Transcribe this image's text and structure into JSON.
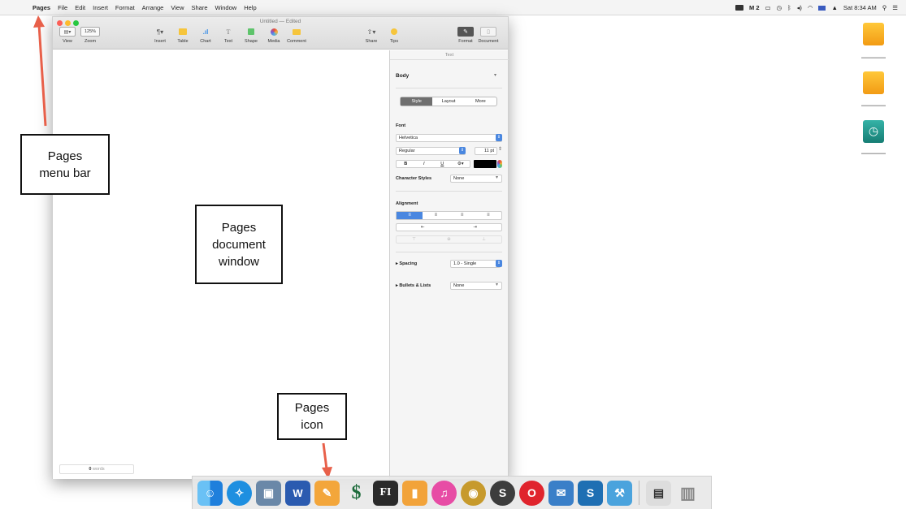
{
  "menubar": {
    "apple_glyph": "",
    "items": [
      "Pages",
      "File",
      "Edit",
      "Insert",
      "Format",
      "Arrange",
      "View",
      "Share",
      "Window",
      "Help"
    ],
    "status": {
      "battery_badge": "2",
      "clock": "Sat 8:34 AM"
    }
  },
  "window": {
    "title": "Untitled — Edited",
    "toolbar": {
      "view_label": "View",
      "zoom_value": "125%",
      "zoom_label": "Zoom",
      "insert_label": "Insert",
      "table_label": "Table",
      "chart_label": "Chart",
      "text_label": "Text",
      "shape_label": "Shape",
      "media_label": "Media",
      "comment_label": "Comment",
      "share_label": "Share",
      "tips_label": "Tips",
      "format_label": "Format",
      "document_label": "Document"
    },
    "word_count": {
      "number": "0",
      "unit": "words"
    }
  },
  "inspector": {
    "header": "Text",
    "paragraph_style": "Body",
    "tabs": [
      "Style",
      "Layout",
      "More"
    ],
    "font_section": "Font",
    "font_family": "Helvetica",
    "typeface": "Regular",
    "font_size": "11 pt",
    "format_buttons": [
      "B",
      "I",
      "U"
    ],
    "char_styles_label": "Character Styles",
    "char_styles_value": "None",
    "alignment_section": "Alignment",
    "spacing_label": "Spacing",
    "spacing_value": "1.0 - Single",
    "bullets_label": "Bullets & Lists",
    "bullets_value": "None"
  },
  "annotations": {
    "menubar_note": [
      "Pages",
      "menu bar"
    ],
    "window_note": [
      "Pages",
      "document",
      "window"
    ],
    "icon_note": [
      "Pages",
      "icon"
    ]
  },
  "colors": {
    "arrow": "#e8604a",
    "accent": "#4a87e0",
    "close": "#fc5f57",
    "minimize": "#fdbb2d",
    "zoom": "#27c840"
  }
}
